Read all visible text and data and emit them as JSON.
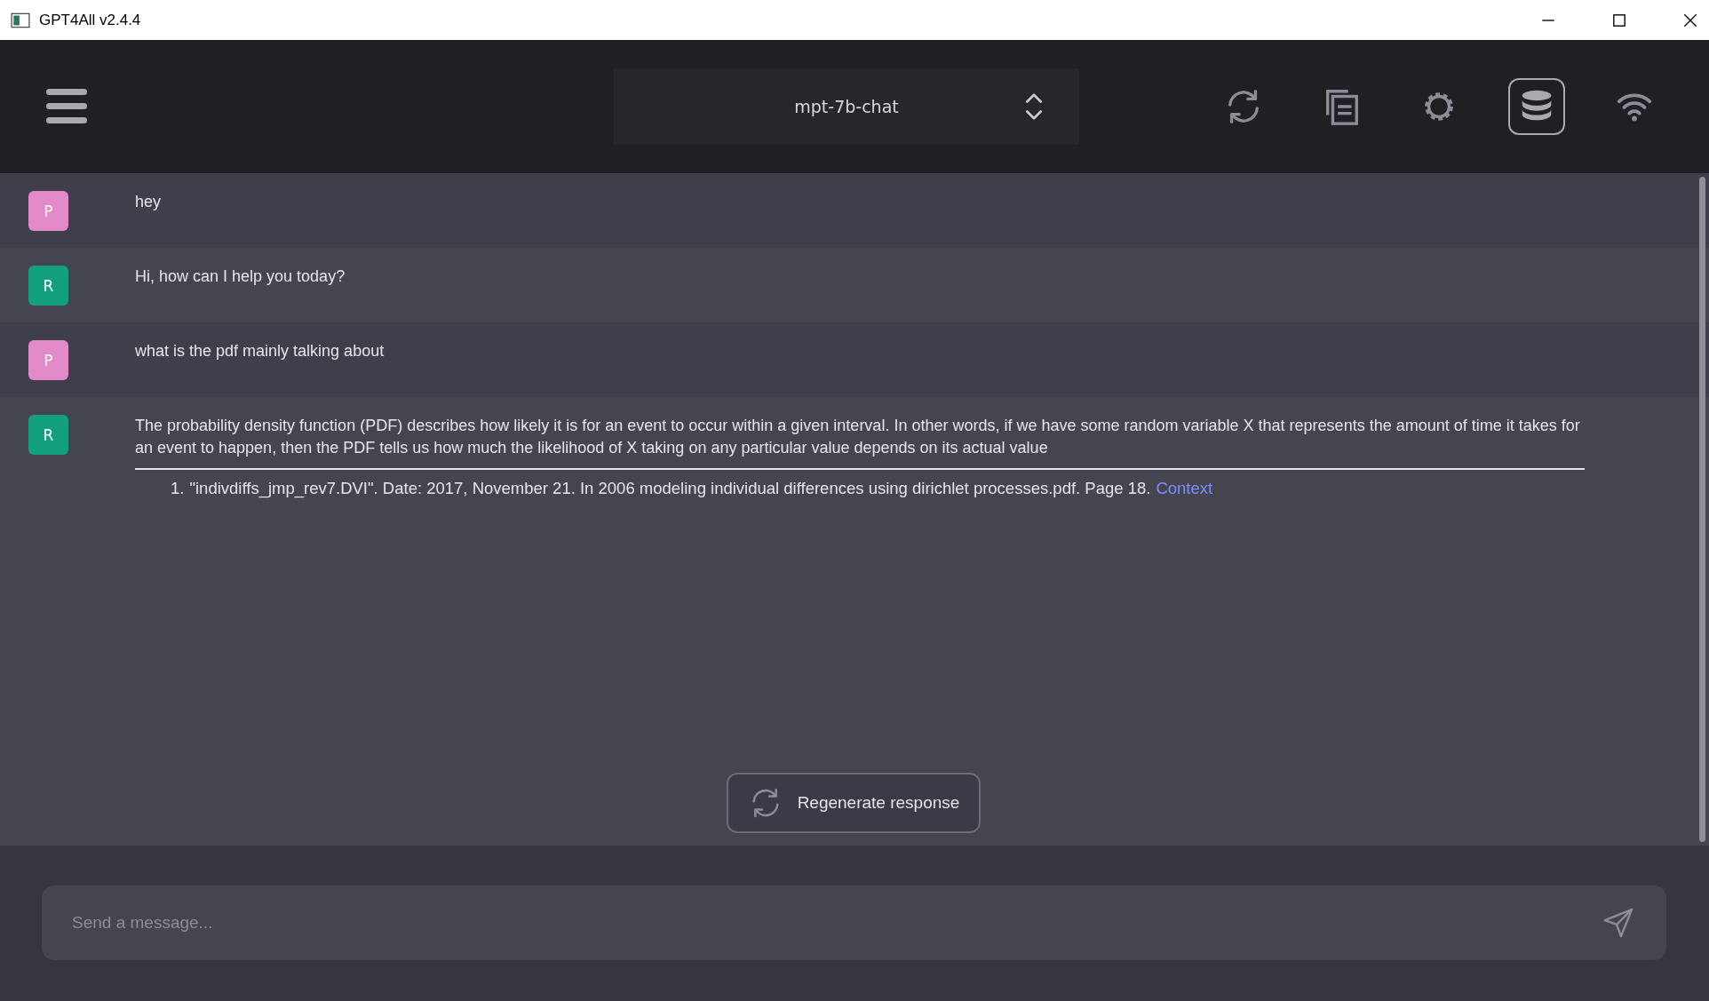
{
  "window": {
    "title": "GPT4All v2.4.4"
  },
  "header": {
    "model": "mpt-7b-chat",
    "tools": [
      {
        "kind": "reset",
        "selected": false
      },
      {
        "kind": "copy",
        "selected": false
      },
      {
        "kind": "settings",
        "selected": false
      },
      {
        "kind": "database",
        "selected": true
      },
      {
        "kind": "network",
        "selected": false
      }
    ]
  },
  "messages": [
    {
      "kind": "prompt",
      "avatar": "P",
      "text": "hey"
    },
    {
      "kind": "response",
      "avatar": "R",
      "text": "Hi, how can I help you today?"
    },
    {
      "kind": "prompt",
      "avatar": "P",
      "text": "what is the pdf mainly talking about"
    },
    {
      "kind": "response",
      "avatar": "R",
      "text": "The probability density function (PDF) describes how likely it is for an event to occur within a given interval. In other words, if we have some random variable X that represents the amount of time it takes for an event to happen, then the PDF tells us how much the likelihood of X taking on any particular value depends on its actual value",
      "references": [
        {
          "number": "1.",
          "text": "\"indivdiffs_jmp_rev7.DVI\". Date: 2017, November 21. In 2006 modeling individual differences using dirichlet processes.pdf. Page 18.",
          "link": "Context"
        }
      ]
    }
  ],
  "regenerate_button": "Regenerate response",
  "input": {
    "placeholder": "Send a message..."
  }
}
